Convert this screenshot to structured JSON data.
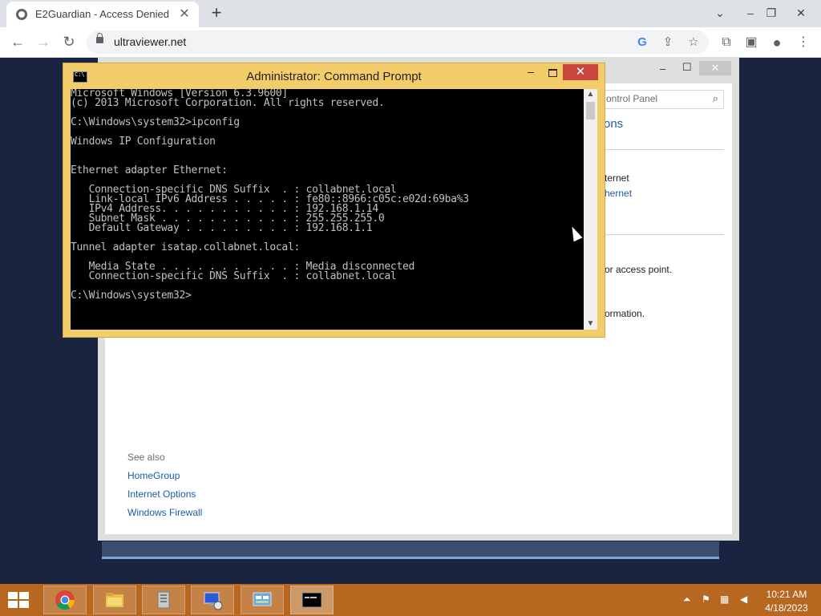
{
  "browser": {
    "tab_title": "E2Guardian - Access Denied",
    "tab_close": "✕",
    "new_tab": "+",
    "url": "ultraviewer.net",
    "back": "←",
    "forward": "→",
    "reload": "↻",
    "controls": {
      "minimize": "⌄",
      "restore": "–",
      "maximize": "❐",
      "close": "✕"
    },
    "omnibox_icons": {
      "google": "G",
      "share": "⇪",
      "bookmark": "☆"
    },
    "toolbar_icons": {
      "extensions": "⧉",
      "sidebar": "▣",
      "profile": "●",
      "menu": "⋮"
    }
  },
  "control_panel": {
    "search_placeholder": "ontrol Panel",
    "heading": "ons",
    "connection_label": "ternet",
    "connection_link": "hernet",
    "text_access_point": " or access point.",
    "text_information": "ormation.",
    "see_also": {
      "title": "See also",
      "links": [
        "HomeGroup",
        "Internet Options",
        "Windows Firewall"
      ]
    },
    "controls": {
      "minimize": "–",
      "maximize": "☐",
      "close": "✕"
    }
  },
  "cmd": {
    "title": "Administrator:  Command Prompt",
    "controls": {
      "minimize": "–",
      "close": "✕"
    },
    "lines": [
      "Microsoft Windows [Version 6.3.9600]",
      "(c) 2013 Microsoft Corporation. All rights reserved.",
      "",
      "C:\\Windows\\system32>ipconfig",
      "",
      "Windows IP Configuration",
      "",
      "",
      "Ethernet adapter Ethernet:",
      "",
      "   Connection-specific DNS Suffix  . : collabnet.local",
      "   Link-local IPv6 Address . . . . . : fe80::8966:c05c:e02d:69ba%3",
      "   IPv4 Address. . . . . . . . . . . : 192.168.1.14",
      "   Subnet Mask . . . . . . . . . . . : 255.255.255.0",
      "   Default Gateway . . . . . . . . . : 192.168.1.1",
      "",
      "Tunnel adapter isatap.collabnet.local:",
      "",
      "   Media State . . . . . . . . . . . : Media disconnected",
      "   Connection-specific DNS Suffix  . : collabnet.local",
      "",
      "C:\\Windows\\system32>"
    ]
  },
  "taskbar": {
    "apps": [
      "Google Chrome",
      "File Explorer",
      "Server Manager",
      "Remote Desktop",
      "Control Panel",
      "Command Prompt"
    ],
    "tray": {
      "up_arrow": "⏶",
      "flag": "⚑",
      "network": "▦",
      "volume": "◀"
    },
    "time": "10:21 AM",
    "date": "4/18/2023"
  },
  "colors": {
    "taskbar": "#b7671f",
    "cmd_frame": "#f4cd6b",
    "close_red": "#c9463d",
    "link_blue": "#1e5aa8"
  }
}
